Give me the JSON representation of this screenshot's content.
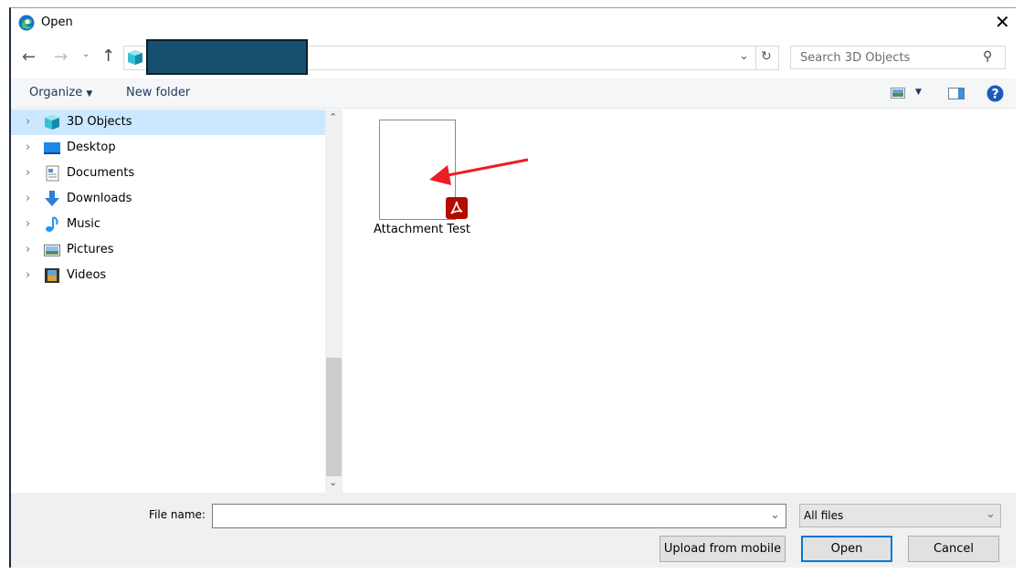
{
  "window": {
    "title": "Open",
    "close_icon": "close-icon",
    "app_icon": "edge-browser-icon"
  },
  "nav": {
    "back_icon": "arrow-left-icon",
    "forward_icon": "arrow-right-icon",
    "recent_icon": "chevron-down-icon",
    "up_icon": "arrow-up-icon",
    "address_icon": "3d-objects-icon",
    "refresh_icon": "refresh-icon"
  },
  "search": {
    "placeholder": "Search 3D Objects"
  },
  "toolbar": {
    "organize": "Organize",
    "new_folder": "New folder"
  },
  "sidebar": {
    "items": [
      {
        "label": "3D Objects",
        "icon": "3d-objects-icon",
        "selected": true
      },
      {
        "label": "Desktop",
        "icon": "desktop-icon"
      },
      {
        "label": "Documents",
        "icon": "documents-icon"
      },
      {
        "label": "Downloads",
        "icon": "downloads-icon"
      },
      {
        "label": "Music",
        "icon": "music-icon"
      },
      {
        "label": "Pictures",
        "icon": "pictures-icon"
      },
      {
        "label": "Videos",
        "icon": "videos-icon"
      }
    ]
  },
  "files": [
    {
      "name": "Attachment Test",
      "type_icon": "pdf-icon"
    }
  ],
  "annotation": {
    "arrow_color": "#ee1c24"
  },
  "footer": {
    "file_name_label": "File name:",
    "file_name_value": "",
    "filter": "All files",
    "upload": "Upload from mobile",
    "open": "Open",
    "cancel": "Cancel"
  },
  "colors": {
    "selection": "#cce8ff",
    "accent": "#0078d7",
    "redaction": "#17506f"
  }
}
